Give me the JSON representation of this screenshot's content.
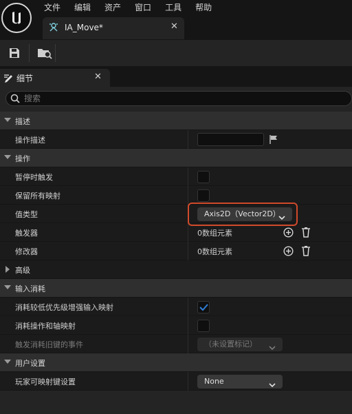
{
  "menu": [
    "文件",
    "编辑",
    "资产",
    "窗口",
    "工具",
    "帮助"
  ],
  "asset_tab": {
    "title": "IA_Move*"
  },
  "panel_tab": {
    "title": "细节"
  },
  "search": {
    "placeholder": "搜索",
    "value": ""
  },
  "sections": {
    "description": {
      "title": "描述",
      "action_description": {
        "label": "操作描述",
        "value": ""
      }
    },
    "action": {
      "title": "操作",
      "trigger_when_paused": {
        "label": "暂停时触发",
        "checked": false
      },
      "reserve_all_mappings": {
        "label": "保留所有映射",
        "checked": false
      },
      "value_type": {
        "label": "值类型",
        "value": "Axis2D（Vector2D）"
      },
      "triggers": {
        "label": "触发器",
        "value": "0数组元素"
      },
      "modifiers": {
        "label": "修改器",
        "value": "0数组元素"
      }
    },
    "advanced": {
      "title": "高级"
    },
    "input_consumption": {
      "title": "输入消耗",
      "consume_lower_priority": {
        "label": "消耗较低优先级增强输入映射",
        "checked": true
      },
      "consume_action_and_axis": {
        "label": "消耗操作和轴映射",
        "checked": false
      },
      "trigger_legacy_events": {
        "label": "触发消耗旧键的事件",
        "value": "（未设置标记）"
      }
    },
    "user_settings": {
      "title": "用户设置",
      "player_mappable_key_settings": {
        "label": "玩家可映射键设置",
        "value": "None"
      }
    }
  },
  "colors": {
    "accent_check": "#2f7fd8",
    "highlight_border": "#d14a2b"
  }
}
